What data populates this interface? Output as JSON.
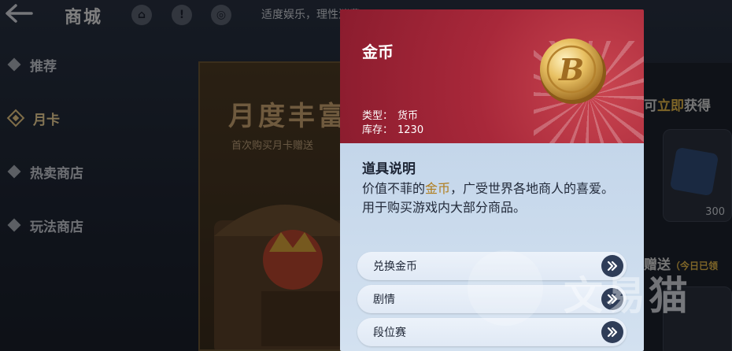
{
  "topbar": {
    "back_icon": "back-arrow-icon",
    "title": "商城",
    "icons": [
      "home-icon",
      "alert-icon",
      "hint-icon"
    ],
    "notice": "适度娱乐，理性消费"
  },
  "sidebar": {
    "items": [
      {
        "label": "推荐",
        "active": false
      },
      {
        "label": "月卡",
        "active": true
      },
      {
        "label": "热卖商店",
        "active": false
      },
      {
        "label": "玩法商店",
        "active": false
      }
    ]
  },
  "banner": {
    "title": "月度丰富",
    "subtitle": "首次购买月卡赠送"
  },
  "right_panel": {
    "heading_prefix": "可",
    "heading_highlight": "立即",
    "heading_suffix": "获得",
    "card_count": "300",
    "heading2": "赠送",
    "heading2_note": "（今日已领"
  },
  "item_panel": {
    "name": "金币",
    "type_label": "类型：",
    "type_value": "货币",
    "stock_label": "库存：",
    "stock_value": "1230",
    "desc_title": "道具说明",
    "desc_part1": "价值不菲的",
    "desc_gold": "金币",
    "desc_part2": "，广受世界各地商人的喜爱。",
    "desc_line2": "用于购买游戏内大部分商品。",
    "sources": [
      {
        "label": "兑换金币"
      },
      {
        "label": "剧情"
      },
      {
        "label": "段位赛"
      }
    ]
  },
  "watermark": {
    "text": "文易猫"
  },
  "colors": {
    "panel_header": "#a8283a",
    "panel_body": "#c4d6ea",
    "gold_text": "#b07d1d",
    "go_button": "#2f3d58"
  }
}
